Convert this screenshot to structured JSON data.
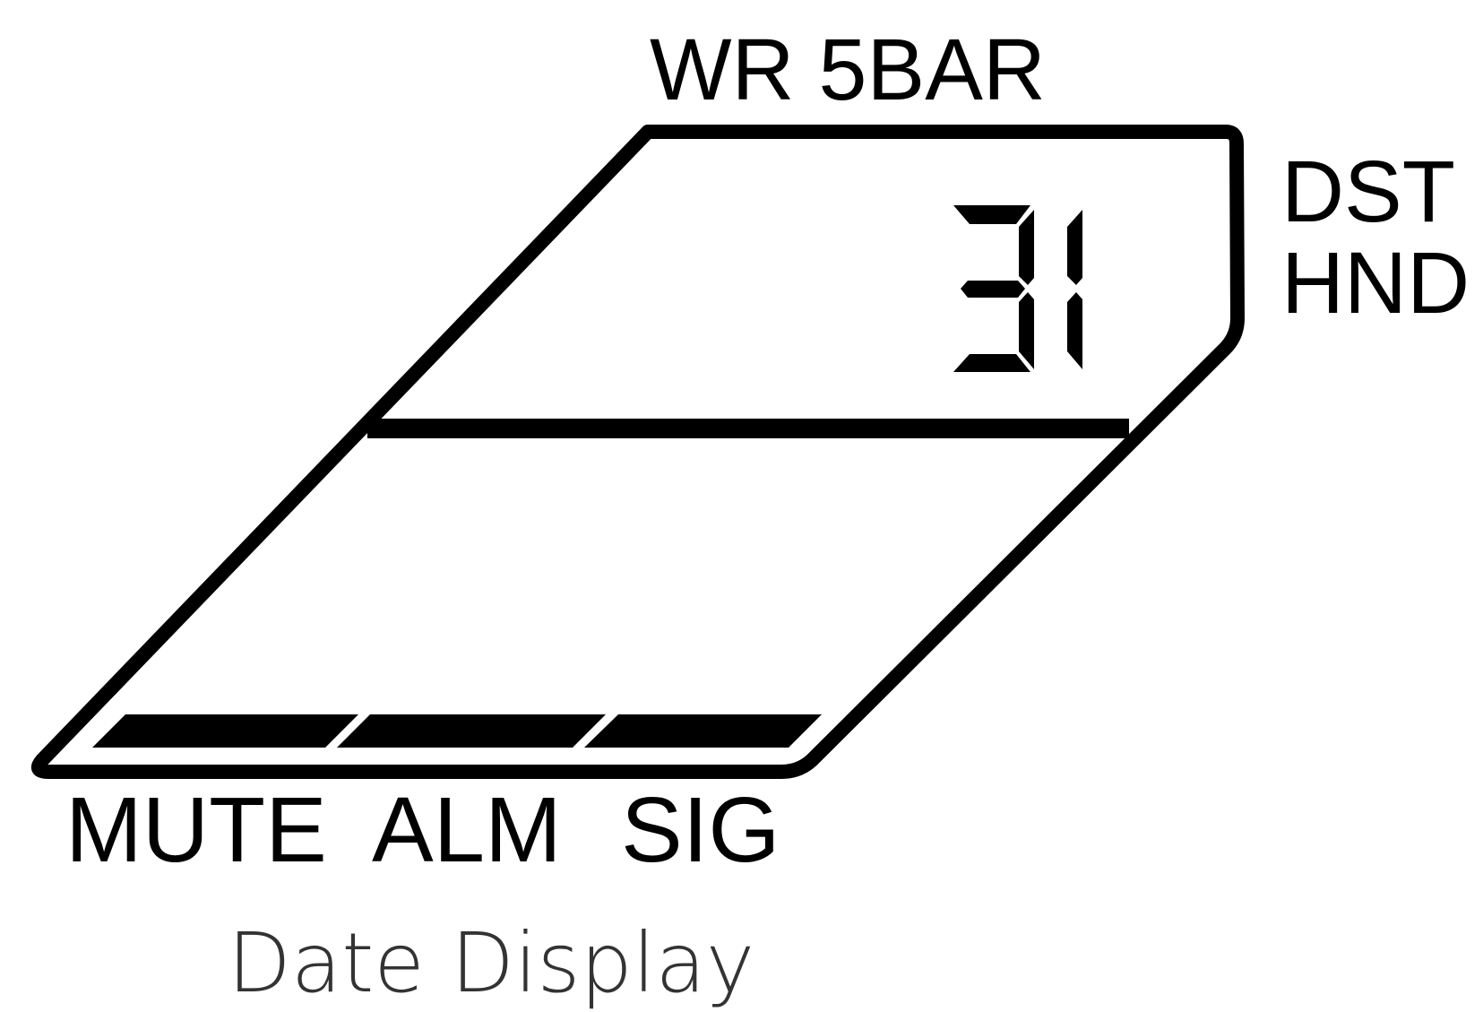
{
  "labels": {
    "top": "WR 5BAR",
    "right_top": "DST",
    "right_bottom": "HND",
    "bottom": [
      "MUTE",
      "ALM",
      "SIG"
    ]
  },
  "display": {
    "value": "31",
    "bar_segments_lit": 3
  },
  "caption": "Date Display",
  "colors": {
    "ink": "#000000",
    "caption": "#333333",
    "background": "#ffffff"
  }
}
